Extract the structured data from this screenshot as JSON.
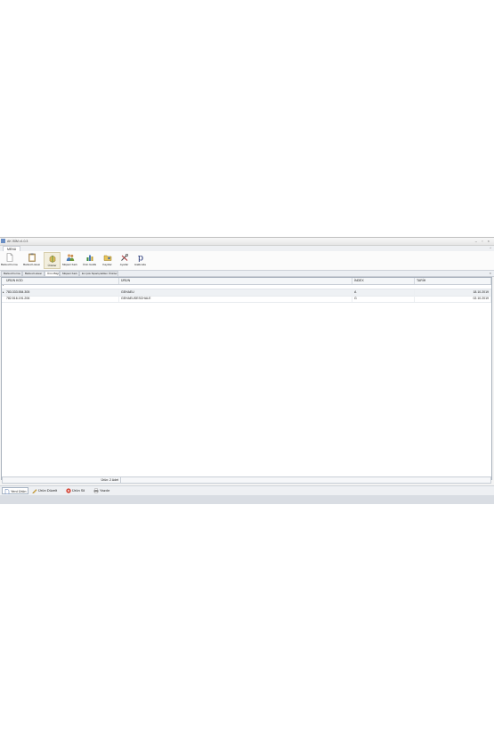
{
  "window": {
    "title": "AK İSİM v1.0.3",
    "controls": "– ▫ ×"
  },
  "menu": {
    "tab_label": "MENU",
    "expand_glyph": "^"
  },
  "ribbon": {
    "buttons": [
      {
        "label": "Barkod Formu",
        "icon": "document-icon"
      },
      {
        "label": "Barkod Listesi",
        "icon": "clipboard-icon"
      },
      {
        "label": "Ürünler",
        "icon": "box-icon"
      },
      {
        "label": "Müşteri Kartı",
        "icon": "people-icon"
      },
      {
        "label": "Ürün Grafik",
        "icon": "chart-icon"
      },
      {
        "label": "Kayıtlar",
        "icon": "folder-icon"
      },
      {
        "label": "Ayarlar",
        "icon": "tools-icon"
      },
      {
        "label": "Hakkında",
        "icon": "p-logo-icon"
      }
    ]
  },
  "doc_tabs": {
    "tabs": [
      "Barkod Formu",
      "Barkod Listesi",
      "Ürün Bilgi",
      "Müşteri Kartı",
      "En Çok Sipariş Edilen Ürünler"
    ],
    "close_glyph": "×"
  },
  "grid": {
    "columns": [
      "ÜRÜN KOD",
      "ÜRÜN",
      "İNDEX",
      "TARİH"
    ],
    "filter_glyph": "*",
    "pointer_glyph": "▸",
    "rows": [
      {
        "kod": "783.333.554.305",
        "urun": "GEHAEU",
        "index": "A",
        "tarih": "18.10.2019"
      },
      {
        "kod": "782.516.191.206",
        "urun": "GEHAEUSESCHALE",
        "index": "G",
        "tarih": "02.10.2019"
      }
    ]
  },
  "footer": {
    "count_text": "Ürün: 2 Adet"
  },
  "toolbar": {
    "buttons": [
      {
        "label": "Yeni Ürün",
        "icon": "new-document-icon"
      },
      {
        "label": "Ürün Düzelt",
        "icon": "pencil-icon"
      },
      {
        "label": "Ürün Sil",
        "icon": "delete-icon"
      },
      {
        "label": "Yazdır",
        "icon": "printer-icon"
      }
    ]
  },
  "colors": {
    "accent": "#6b8fc4",
    "delete": "#d23a2a"
  }
}
